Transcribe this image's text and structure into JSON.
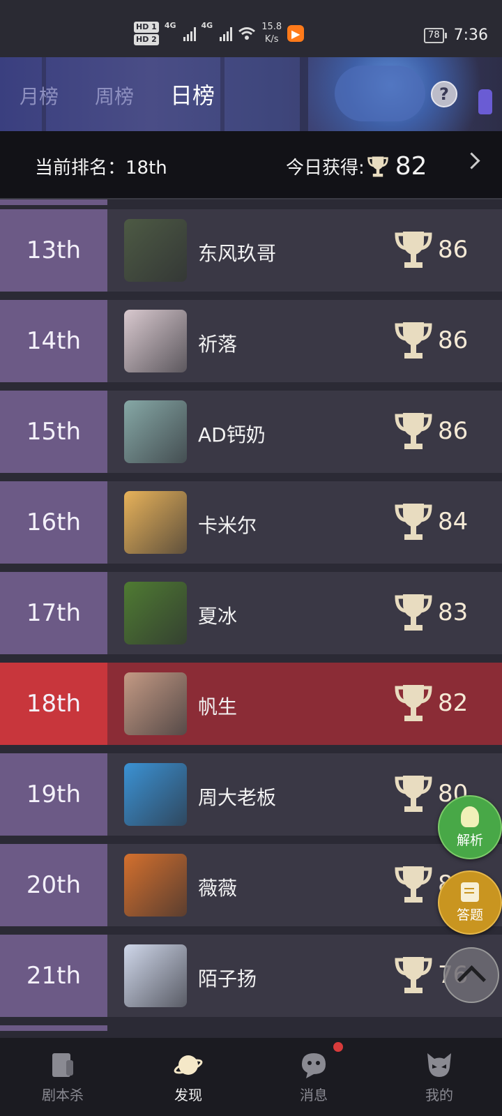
{
  "status_bar": {
    "hd1": "HD 1",
    "hd2": "HD 2",
    "sig1": "4G",
    "sig2": "4G",
    "net_speed_value": "15.8",
    "net_speed_unit": "K/s",
    "battery": "78",
    "time": "7:36"
  },
  "tabs": [
    "月榜",
    "周榜",
    "日榜"
  ],
  "active_tab": "日榜",
  "summary": {
    "rank_label": "当前排名：",
    "rank_value": "18th",
    "today_label": "今日获得:",
    "today_score": "82"
  },
  "rows": [
    {
      "rank": "13th",
      "name": "东风玖哥",
      "score": "86",
      "avatar_color": "#4d5a44"
    },
    {
      "rank": "14th",
      "name": "祈落",
      "score": "86",
      "avatar_color": "#d9c9cf"
    },
    {
      "rank": "15th",
      "name": "AD钙奶",
      "score": "86",
      "avatar_color": "#86a8a6"
    },
    {
      "rank": "16th",
      "name": "卡米尔",
      "score": "84",
      "avatar_color": "#e7b25a"
    },
    {
      "rank": "17th",
      "name": "夏冰",
      "score": "83",
      "avatar_color": "#4f7b32"
    },
    {
      "rank": "18th",
      "name": "帆生",
      "score": "82",
      "avatar_color": "#c49a84"
    },
    {
      "rank": "19th",
      "name": "周大老板",
      "score": "80",
      "avatar_color": "#3b92d4"
    },
    {
      "rank": "20th",
      "name": "薇薇",
      "score": "80",
      "avatar_color": "#d4702e"
    },
    {
      "rank": "21th",
      "name": "陌子扬",
      "score": "76",
      "avatar_color": "#cfd7ea"
    }
  ],
  "current_rank": "18th",
  "fab": {
    "analyze_label": "解析",
    "answer_label": "答题"
  },
  "bottom_nav": [
    {
      "label": "剧本杀",
      "icon": "script-book-icon"
    },
    {
      "label": "发现",
      "icon": "planet-icon"
    },
    {
      "label": "消息",
      "icon": "chat-ghost-icon"
    },
    {
      "label": "我的",
      "icon": "mask-face-icon"
    }
  ],
  "active_nav": "发现",
  "colors": {
    "rank_cell": "#6c5a86",
    "row_bg": "#3a3845",
    "current_row": "#8b2c36",
    "current_rank_cell": "#c8363c",
    "trophy": "#e8dcc0",
    "analyze_fab": "#48a847",
    "answer_fab": "#c99520"
  }
}
